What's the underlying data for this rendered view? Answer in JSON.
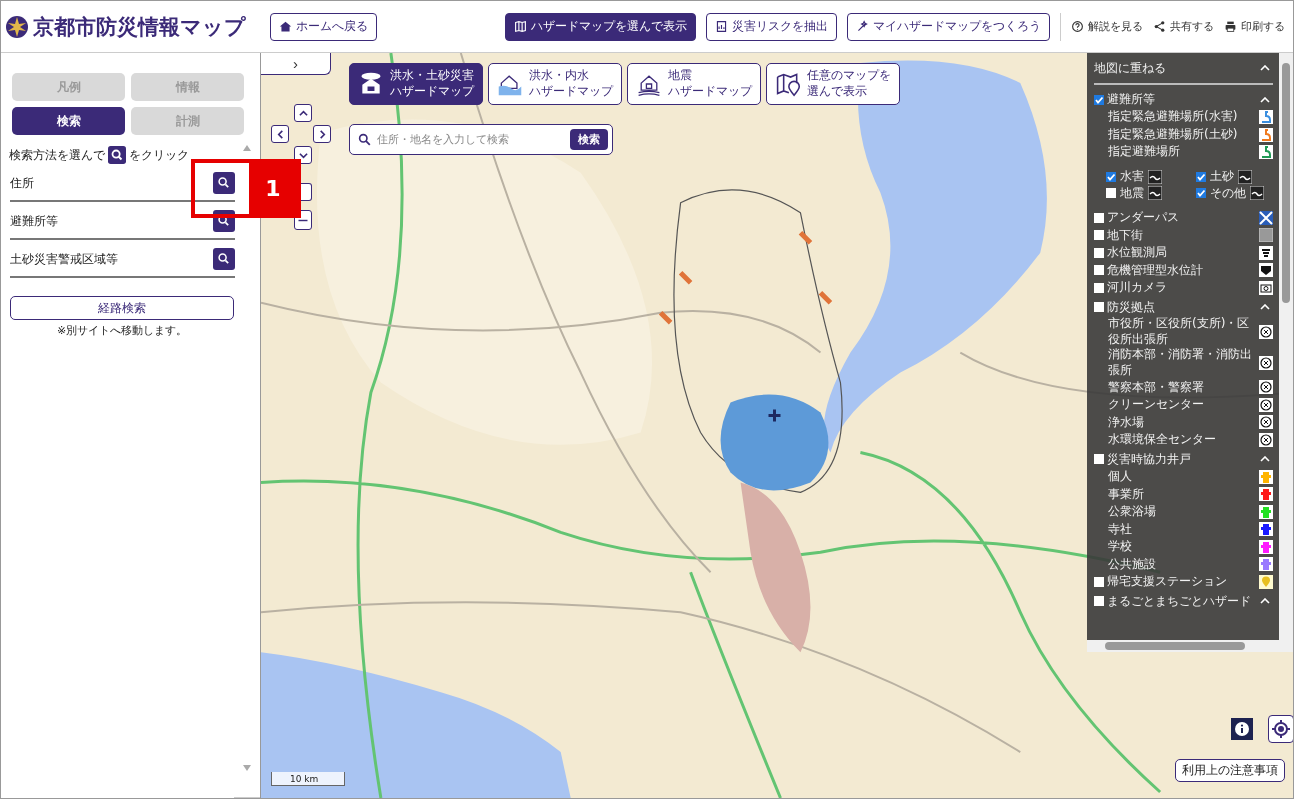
{
  "header": {
    "title": "京都市防災情報マップ",
    "home_button": "ホームへ戻る",
    "actions": [
      {
        "label": "ハザードマップを選んで表示",
        "selected": true
      },
      {
        "label": "災害リスクを抽出",
        "selected": false
      },
      {
        "label": "マイハザードマップをつくろう",
        "selected": false
      }
    ],
    "links": [
      "解説を見る",
      "共有する",
      "印刷する"
    ]
  },
  "sidebar": {
    "tabs": [
      {
        "label": "凡例",
        "selected": false
      },
      {
        "label": "情報",
        "selected": false
      },
      {
        "label": "検索",
        "selected": true
      },
      {
        "label": "計測",
        "selected": false
      }
    ],
    "instruction_before": "検索方法を選んで",
    "instruction_after": "をクリック",
    "search_items": [
      "住所",
      "避難所等",
      "土砂災害警戒区域等"
    ],
    "route_button": "経路検索",
    "route_note": "※別サイトへ移動します。"
  },
  "map": {
    "expand_button": "›",
    "hazard_buttons": [
      {
        "line1": "洪水・土砂災害",
        "line2": "ハザードマップ",
        "selected": true
      },
      {
        "line1": "洪水・内水",
        "line2": "ハザードマップ",
        "selected": false
      },
      {
        "line1": "地震",
        "line2": "ハザードマップ",
        "selected": false
      },
      {
        "line1": "任意のマップを",
        "line2": "選んで表示",
        "selected": false
      }
    ],
    "search": {
      "placeholder": "住所・地名を入力して検索",
      "button": "検索"
    },
    "scale": "10 km",
    "notice_button": "利用上の注意事項"
  },
  "layer_panel": {
    "title": "地図に重ねる",
    "expanded": true,
    "layers": [
      {
        "kind": "group",
        "label": "避難所等",
        "checked": true,
        "expanded": true,
        "children": [
          {
            "label": "指定緊急避難場所(水害)",
            "color": "#3a8fe0"
          },
          {
            "label": "指定緊急避難場所(土砂)",
            "color": "#f07a1e"
          },
          {
            "label": "指定避難場所",
            "color": "#1f9a55"
          }
        ],
        "filters": [
          {
            "label": "水害",
            "checked": true
          },
          {
            "label": "土砂",
            "checked": true
          },
          {
            "label": "地震",
            "checked": false
          },
          {
            "label": "その他",
            "checked": true
          }
        ]
      },
      {
        "kind": "layer",
        "label": "アンダーパス",
        "checked": false
      },
      {
        "kind": "layer",
        "label": "地下街",
        "checked": false
      },
      {
        "kind": "layer",
        "label": "水位観測局",
        "checked": false
      },
      {
        "kind": "layer",
        "label": "危機管理型水位計",
        "checked": false
      },
      {
        "kind": "layer",
        "label": "河川カメラ",
        "checked": false
      },
      {
        "kind": "group",
        "label": "防災拠点",
        "checked": false,
        "expanded": true,
        "children": [
          {
            "label": "市役所・区役所(支所)・区役所出張所"
          },
          {
            "label": "消防本部・消防署・消防出張所"
          },
          {
            "label": "警察本部・警察署"
          },
          {
            "label": "クリーンセンター"
          },
          {
            "label": "浄水場"
          },
          {
            "label": "水環境保全センター"
          }
        ]
      },
      {
        "kind": "group",
        "label": "災害時協力井戸",
        "checked": false,
        "expanded": true,
        "children": [
          {
            "label": "個人",
            "color": "#ffb400"
          },
          {
            "label": "事業所",
            "color": "#ff1a1a"
          },
          {
            "label": "公衆浴場",
            "color": "#22e022"
          },
          {
            "label": "寺社",
            "color": "#1a1aff"
          },
          {
            "label": "学校",
            "color": "#ff1aff"
          },
          {
            "label": "公共施設",
            "color": "#9a7aff"
          }
        ]
      },
      {
        "kind": "layer",
        "label": "帰宅支援ステーション",
        "checked": false
      },
      {
        "kind": "group",
        "label": "まるごとまちごとハザード",
        "checked": false,
        "expanded": true
      }
    ]
  },
  "annotation": {
    "label": "1"
  }
}
